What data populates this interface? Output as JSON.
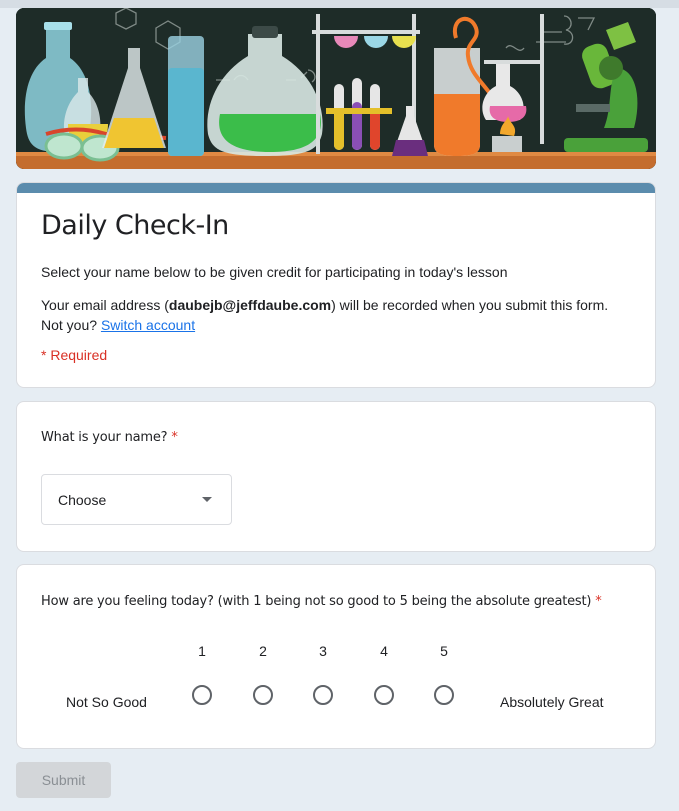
{
  "header": {
    "banner_alt": "science lab illustration",
    "accent_color": "#5b8cad"
  },
  "form": {
    "title": "Daily Check-In",
    "description": "Select your name below to be given credit for participating in today's lesson",
    "email_prefix": "Your email address (",
    "email": "daubejb@jeffdaube.com",
    "email_suffix": ") will be recorded when you submit this form.",
    "not_you": "Not you?",
    "switch_account": "Switch account",
    "required_note": "* Required"
  },
  "question1": {
    "label": "What is your name?",
    "required_mark": "*",
    "dropdown_value": "Choose"
  },
  "question2": {
    "label": "How are you feeling today? (with 1 being not so good to 5 being the absolute greatest)",
    "required_mark": "*",
    "scale": [
      "1",
      "2",
      "3",
      "4",
      "5"
    ],
    "low_label": "Not So Good",
    "high_label": "Absolutely Great"
  },
  "actions": {
    "submit_label": "Submit"
  },
  "colors": {
    "required": "#d93025",
    "link": "#1a73e8",
    "page_bg": "#e6edf3"
  }
}
